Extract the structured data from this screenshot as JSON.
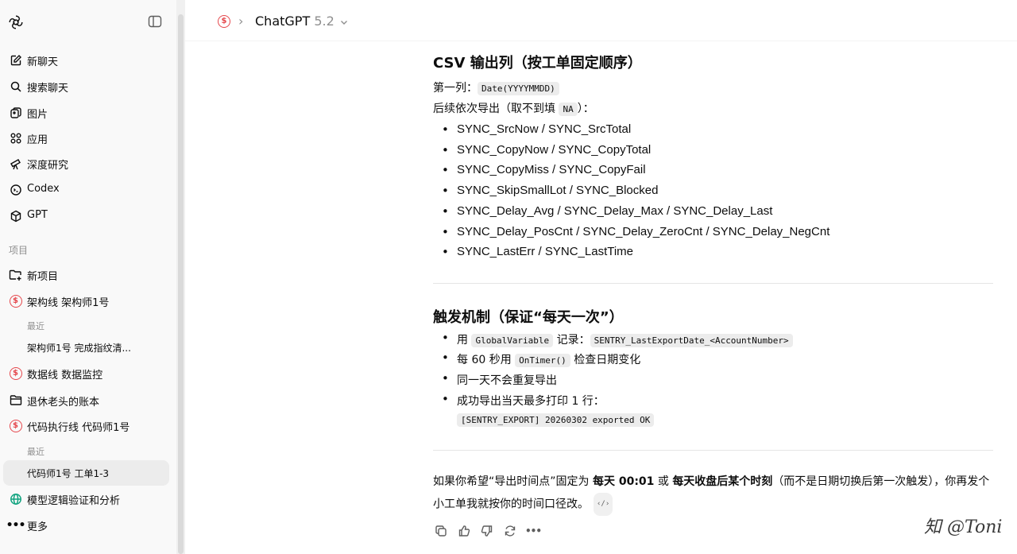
{
  "sidebar": {
    "nav": [
      {
        "label": "新聊天",
        "icon": "new-chat-icon"
      },
      {
        "label": "搜索聊天",
        "icon": "search-icon"
      },
      {
        "label": "图片",
        "icon": "images-icon"
      },
      {
        "label": "应用",
        "icon": "apps-icon"
      },
      {
        "label": "深度研究",
        "icon": "telescope-icon"
      },
      {
        "label": "Codex",
        "icon": "codex-icon"
      },
      {
        "label": "GPT",
        "icon": "gpt-cube-icon"
      }
    ],
    "projects_label": "项目",
    "projects": {
      "new_project": "新项目",
      "p1": "架构线 架构师1号",
      "p1_recent_label": "最近",
      "p1_recent": "架构师1号 完成指纹清...",
      "p2": "数据线 数据监控",
      "p3": "退休老头的账本",
      "p4": "代码执行线 代码师1号",
      "p4_recent_label": "最近",
      "p4_recent": "代码师1号 工单1-3",
      "p5": "模型逻辑验证和分析",
      "more": "更多"
    }
  },
  "header": {
    "model_name": "ChatGPT",
    "model_version": "5.2",
    "chevron": "›"
  },
  "message": {
    "section1_title": "CSV 输出列（按工单固定顺序）",
    "first_col_label": "第一列：",
    "first_col_code": "Date(YYYYMMDD)",
    "subsequent_pre": "后续依次导出（取不到填 ",
    "subsequent_code": "NA",
    "subsequent_post": "）：",
    "columns": [
      "SYNC_SrcNow / SYNC_SrcTotal",
      "SYNC_CopyNow / SYNC_CopyTotal",
      "SYNC_CopyMiss / SYNC_CopyFail",
      "SYNC_SkipSmallLot / SYNC_Blocked",
      "SYNC_Delay_Avg / SYNC_Delay_Max / SYNC_Delay_Last",
      "SYNC_Delay_PosCnt / SYNC_Delay_ZeroCnt / SYNC_Delay_NegCnt",
      "SYNC_LastErr / SYNC_LastTime"
    ],
    "section2_title": "触发机制（保证“每天一次”）",
    "trigger_1_pre": "用 ",
    "trigger_1_code1": "GlobalVariable",
    "trigger_1_mid": " 记录：",
    "trigger_1_code2": "SENTRY_LastExportDate_<AccountNumber>",
    "trigger_2_pre": "每 60 秒用 ",
    "trigger_2_code": "OnTimer()",
    "trigger_2_post": " 检查日期变化",
    "trigger_3": "同一天不会重复导出",
    "trigger_4": "成功导出当天最多打印 1 行：",
    "trigger_4_code": "[SENTRY_EXPORT] 20260302 exported OK",
    "closing_1": "如果你希望“导出时间点”固定为 ",
    "closing_b1": "每天 00:01",
    "closing_2": " 或 ",
    "closing_b2": "每天收盘后某个时刻",
    "closing_3": "（而不是日期切换后第一次触发），你再发个小工单我就按你的时间口径改。",
    "closing_tag": "‹/›"
  },
  "watermark": "知 @Toni",
  "colors": {
    "accent_red": "#e5484d",
    "globe_green": "#10a37f",
    "sidebar_bg": "#f9f9f9"
  }
}
